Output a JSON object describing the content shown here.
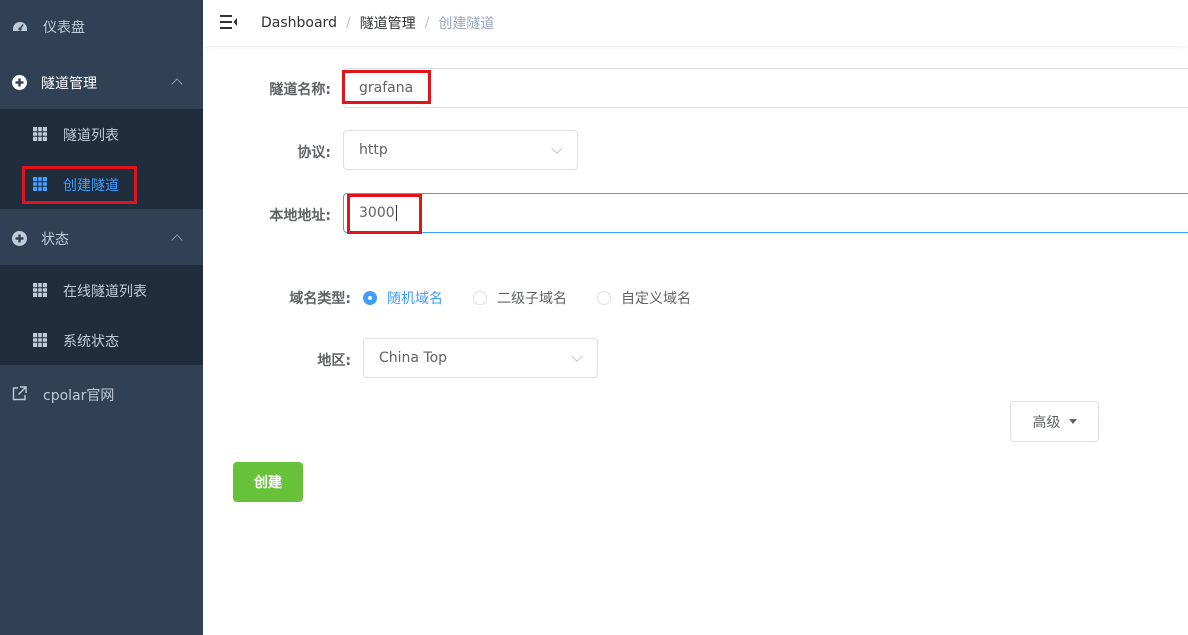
{
  "sidebar": {
    "dashboard": "仪表盘",
    "tunnel_mgmt": "隧道管理",
    "tunnel_list": "隧道列表",
    "create_tunnel": "创建隧道",
    "status": "状态",
    "online_tunnels": "在线隧道列表",
    "system_status": "系统状态",
    "website": "cpolar官网"
  },
  "breadcrumb": [
    "Dashboard",
    "隧道管理",
    "创建隧道"
  ],
  "form": {
    "name_label": "隧道名称:",
    "name_value": "grafana",
    "protocol_label": "协议:",
    "protocol_value": "http",
    "local_label": "本地地址:",
    "local_value": "3000",
    "domain_type_label": "域名类型:",
    "domain_types": [
      "随机域名",
      "二级子域名",
      "自定义域名"
    ],
    "domain_type_selected": "随机域名",
    "region_label": "地区:",
    "region_value": "China Top",
    "advanced": "高级",
    "create": "创建"
  },
  "colors": {
    "sidebar_bg": "#304156",
    "submenu_bg": "#1f2d3d",
    "accent": "#409eff",
    "create_btn": "#67c23a",
    "highlight": "#e0151b"
  }
}
